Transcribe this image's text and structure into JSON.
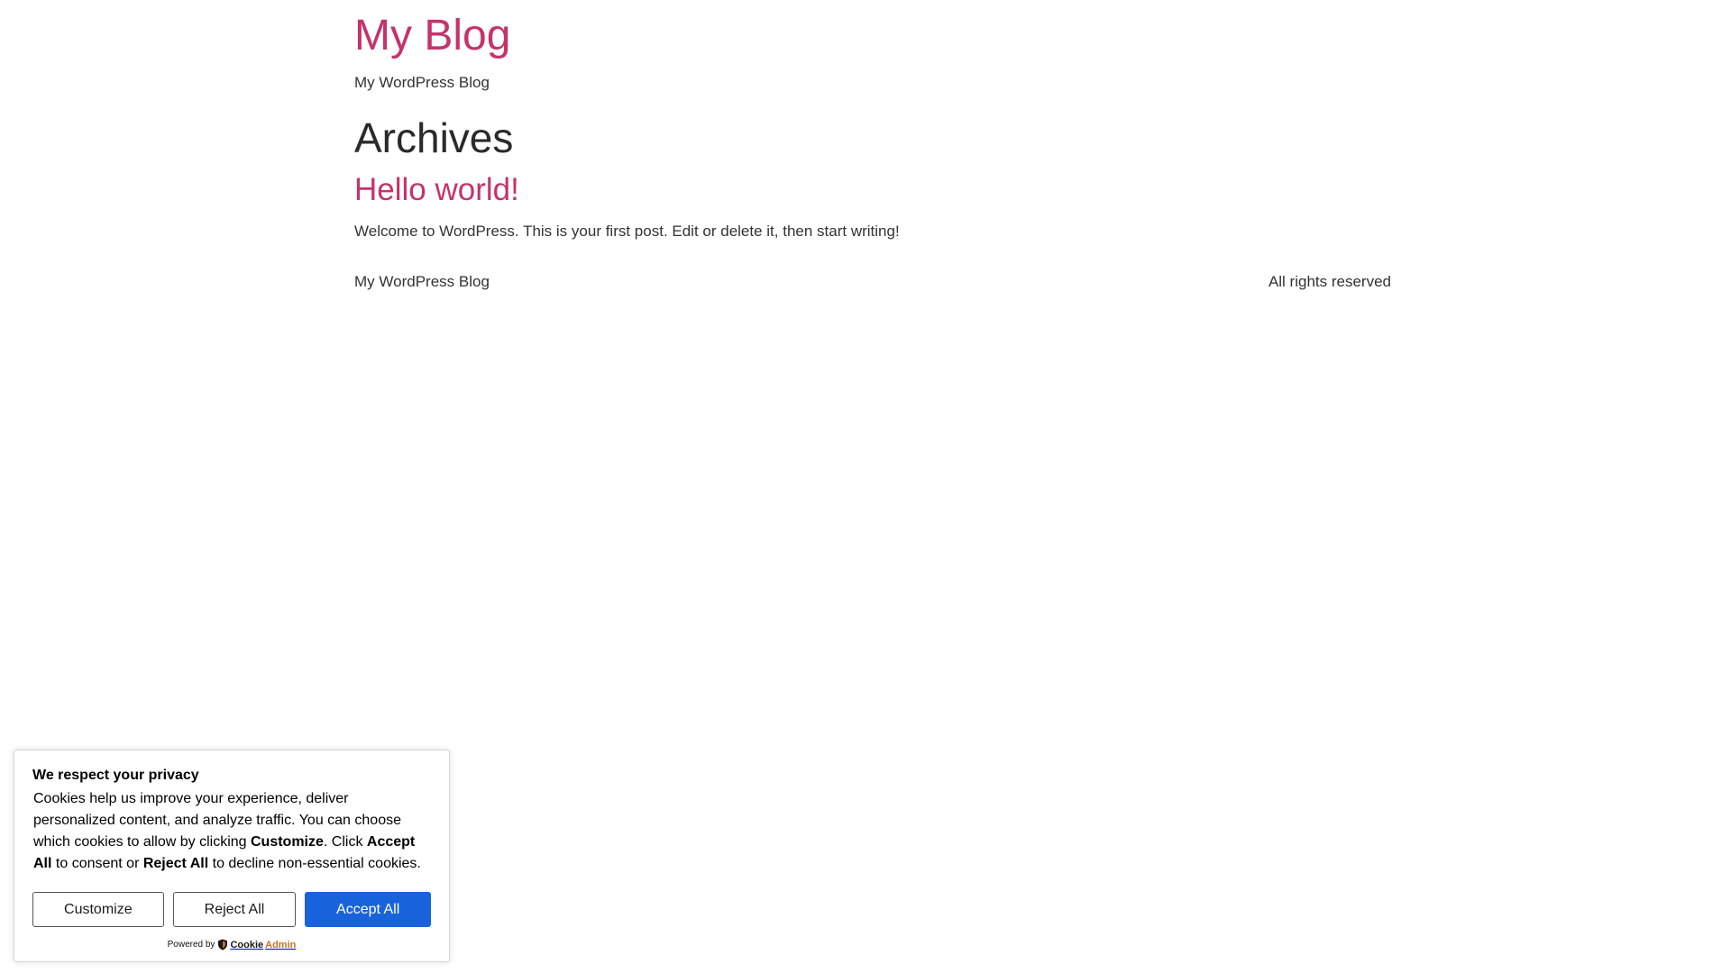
{
  "site": {
    "title": "My Blog",
    "tagline": "My WordPress Blog"
  },
  "archive": {
    "heading": "Archives"
  },
  "posts": [
    {
      "title": "Hello world!",
      "excerpt": "Welcome to WordPress. This is your first post. Edit or delete it, then start writing!"
    }
  ],
  "footer": {
    "left": "My WordPress Blog",
    "right": "All rights reserved"
  },
  "cookie_banner": {
    "heading": "We respect your privacy",
    "text_part1": "Cookies help us improve your experience, deliver personalized content, and analyze traffic. You can choose which cookies to allow by clicking ",
    "text_bold1": "Customize",
    "text_part2": ". Click ",
    "text_bold2": "Accept All",
    "text_part3": " to consent or ",
    "text_bold3": "Reject All",
    "text_part4": " to decline non-essential cookies.",
    "customize_label": "Customize",
    "reject_label": "Reject All",
    "accept_label": "Accept All",
    "powered_by": "Powered by",
    "brand_part1": "Cookie",
    "brand_part2": "Admin"
  },
  "colors": {
    "link": "#c5336b",
    "accept_button": "#1863dc",
    "brand_accent": "#c0771a"
  }
}
